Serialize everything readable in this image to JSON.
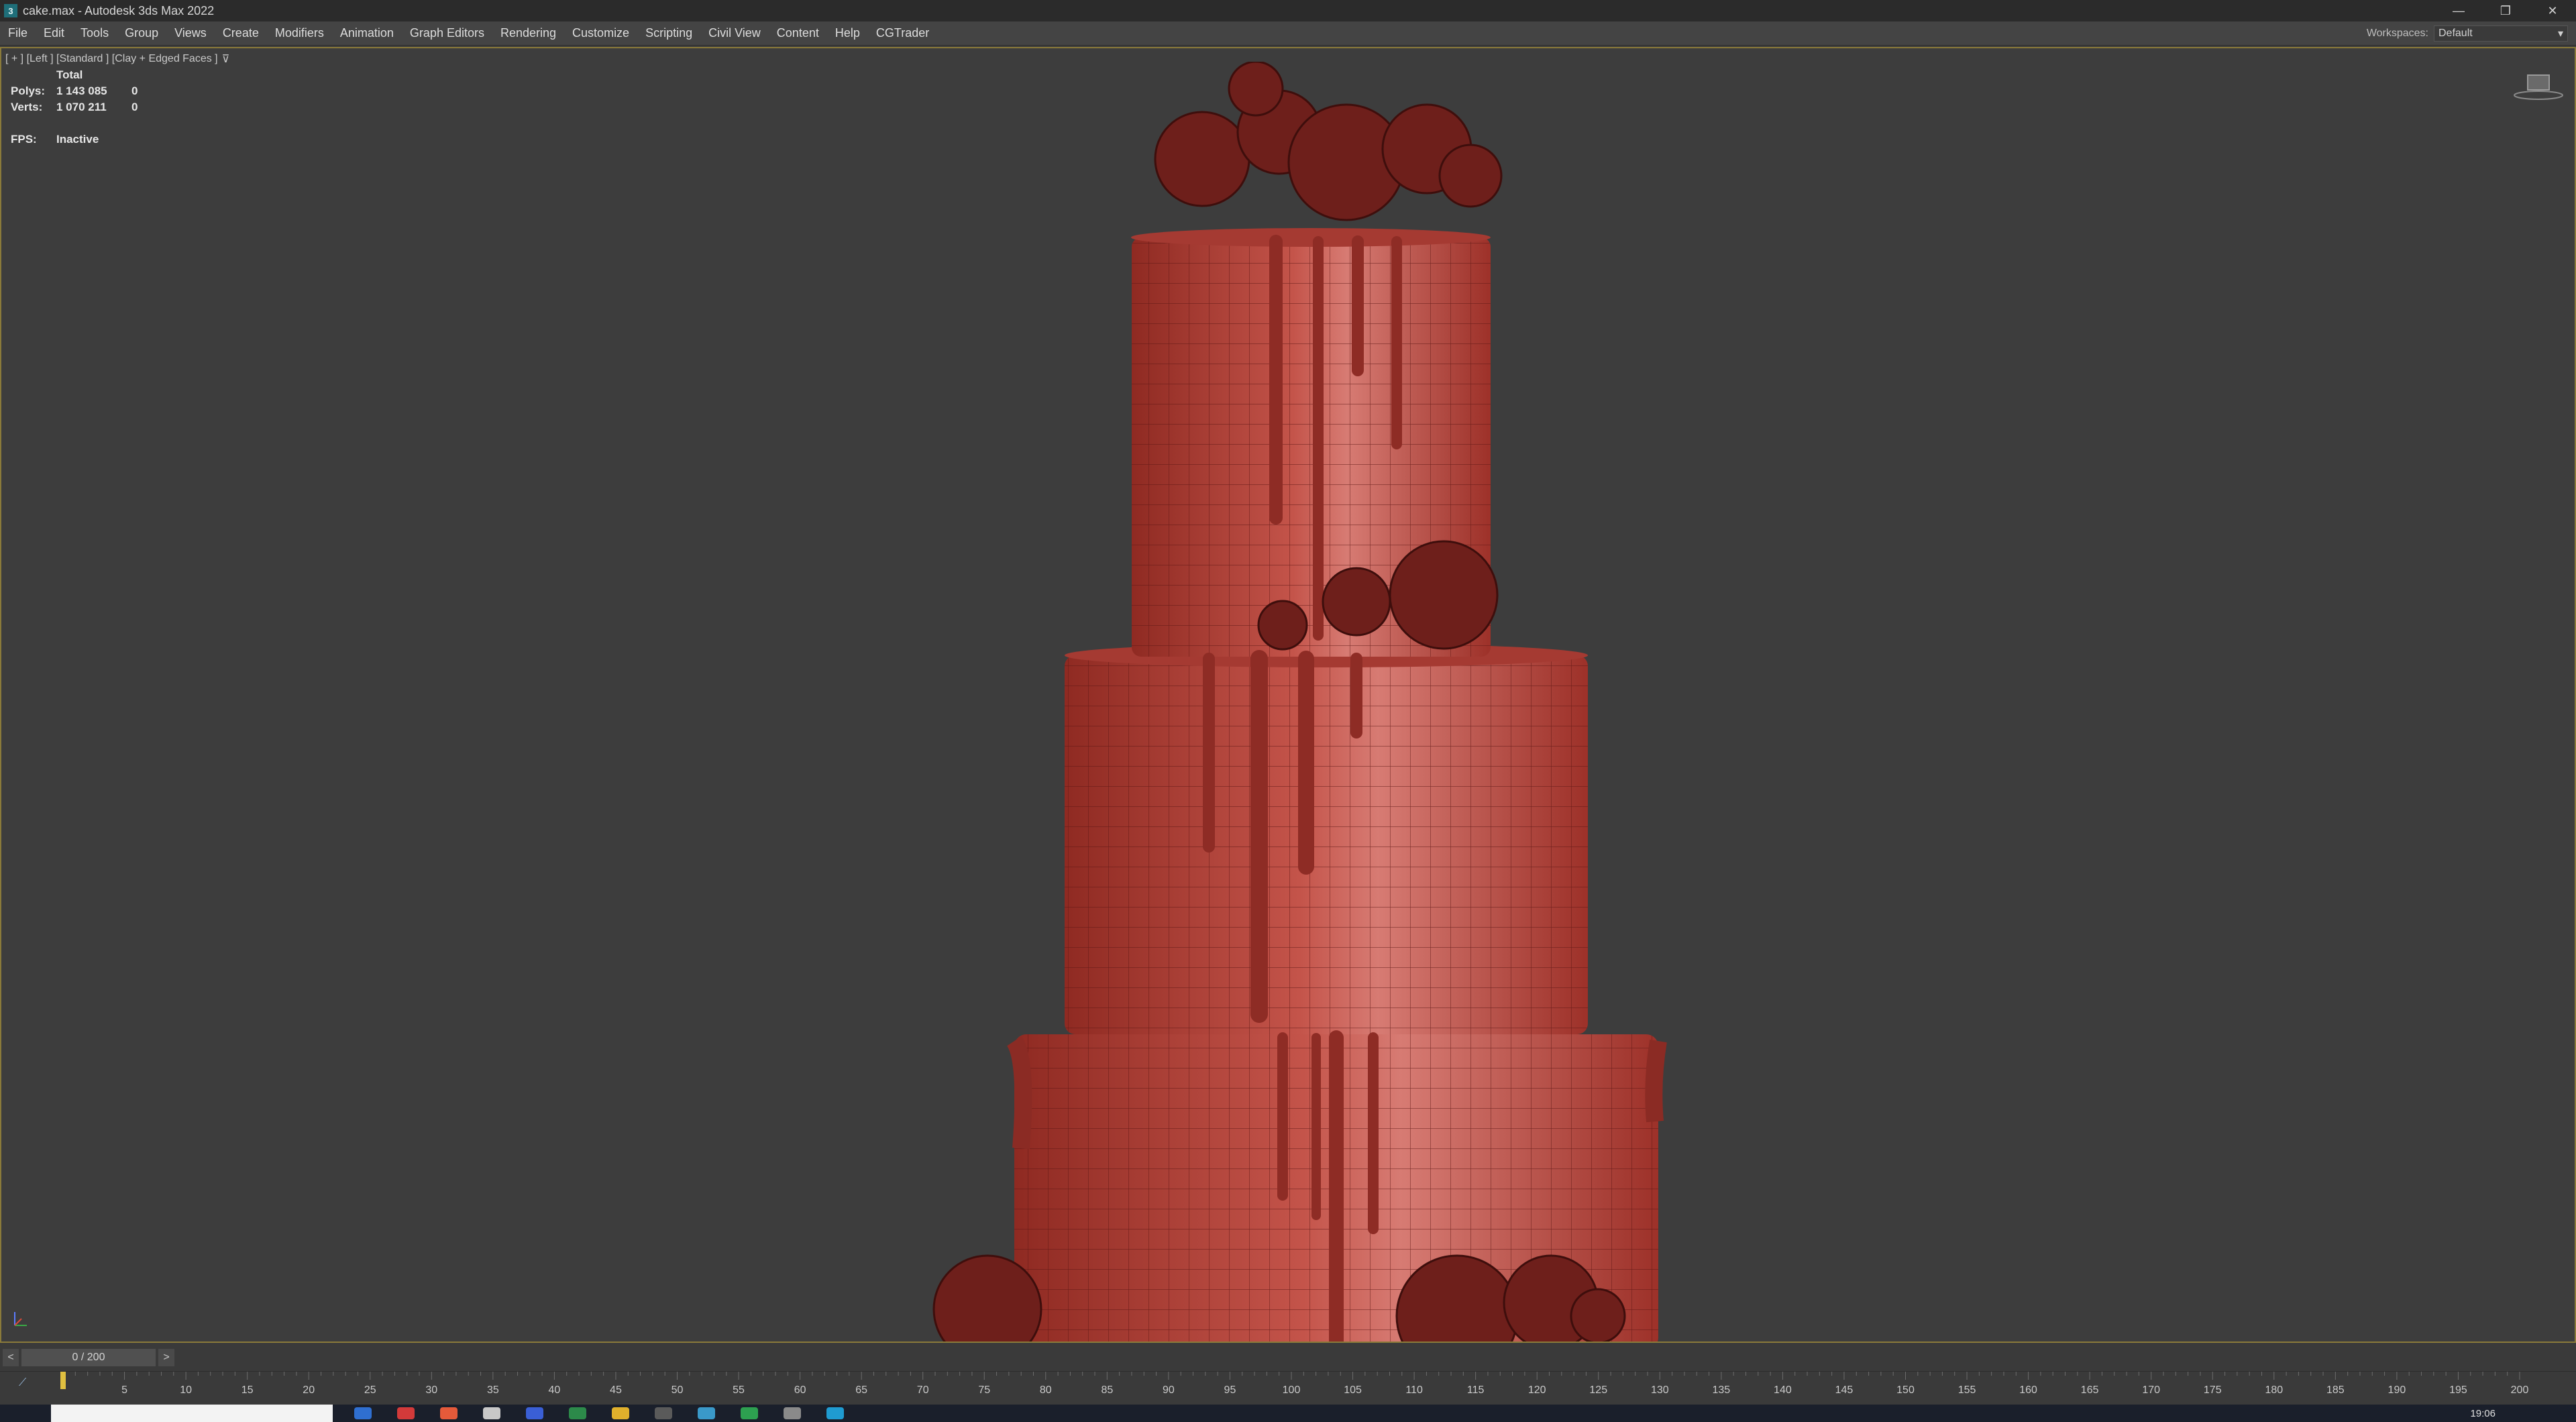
{
  "window": {
    "title": "cake.max - Autodesk 3ds Max 2022",
    "app_icon_letter": "3",
    "minimize": "—",
    "restore": "❐",
    "close": "✕"
  },
  "menu": {
    "items": [
      "File",
      "Edit",
      "Tools",
      "Group",
      "Views",
      "Create",
      "Modifiers",
      "Animation",
      "Graph Editors",
      "Rendering",
      "Customize",
      "Scripting",
      "Civil View",
      "Content",
      "Help",
      "CGTrader"
    ],
    "workspaces_label": "Workspaces:",
    "workspace_value": "Default"
  },
  "viewport": {
    "label": "[ + ] [Left ] [Standard ] [Clay + Edged Faces ]",
    "stats": {
      "total_label": "Total",
      "polys_label": "Polys:",
      "polys_value": "1 143 085",
      "polys_selected": "0",
      "verts_label": "Verts:",
      "verts_value": "1 070 211",
      "verts_selected": "0",
      "fps_label": "FPS:",
      "fps_value": "Inactive"
    },
    "cake_color": "#b9453b",
    "edge_color": "#5a1512"
  },
  "timeslider": {
    "prev": "<",
    "next": ">",
    "frame": "0 / 200"
  },
  "trackbar": {
    "ticks": [
      5,
      10,
      15,
      20,
      25,
      30,
      35,
      40,
      45,
      50,
      55,
      60,
      65,
      70,
      75,
      80,
      85,
      90,
      95,
      100,
      105,
      110,
      115,
      120,
      125,
      130,
      135,
      140,
      145,
      150,
      155,
      160,
      165,
      170,
      175,
      180,
      185,
      190,
      195,
      200
    ]
  },
  "taskbar": {
    "clock": "19:06"
  }
}
